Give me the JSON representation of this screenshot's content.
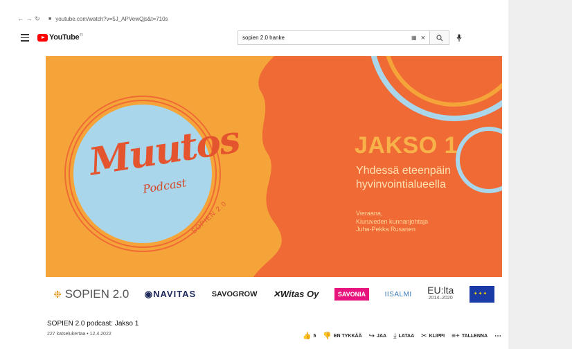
{
  "browser": {
    "url": "youtube.com/watch?v=5J_APVewQjs&t=710s"
  },
  "header": {
    "logo_text": "YouTube",
    "logo_sup": "FI",
    "search_value": "sopien 2.0 hanke"
  },
  "video_frame": {
    "headline": "JAKSO 1",
    "subtitle_line1": "Yhdessä eteenpäin",
    "subtitle_line2": "hyvinvointialueella",
    "guest_line1": "Vieraana,",
    "guest_line2": "Kiuruveden kunnanjohtaja",
    "guest_line3": "Juha-Pekka Rusanen",
    "logo_muutos": "Muutos",
    "logo_podcast": "Podcast",
    "logo_sopien": "SOPIEN 2.0"
  },
  "partner_logos": {
    "sopien": "SOPIEN 2.0",
    "navitas": "NAVITAS",
    "savogrow": "SAVOGROW",
    "witas": "Witas Oy",
    "savonia": "SAVONIA",
    "iisalmi": "IISALMI",
    "eu_text": "EU:lta",
    "eu_years": "2014–2020"
  },
  "video_info": {
    "title": "SOPIEN 2.0 podcast: Jakso 1",
    "views_date": "227 katselukertaa • 12.4.2022",
    "like_count": "5",
    "dislike_label": "EN TYKKÄÄ",
    "share_label": "JAA",
    "download_label": "LATAA",
    "clip_label": "KLIPPI",
    "save_label": "TALLENNA"
  },
  "colors": {
    "orange": "#f5a43a",
    "red_orange": "#ef6a34",
    "circle_blue": "#a9d6ea",
    "youtube_red": "#ff0000"
  }
}
